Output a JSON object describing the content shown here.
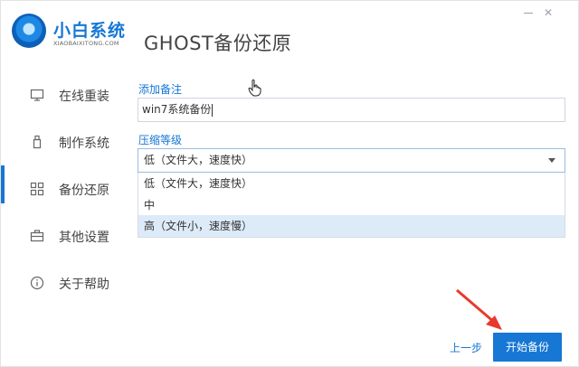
{
  "brand": {
    "name_cn": "小白系统",
    "name_en": "XIAOBAIXITONG.COM",
    "logo_icon": "xiaobai-logo-icon"
  },
  "page_title": "GHOST备份还原",
  "window_controls": {
    "minimize_icon": "minimize-icon",
    "close": "✕"
  },
  "sidebar": {
    "accent_color": "#1677d4",
    "active_index": 2,
    "items": [
      {
        "label": "在线重装",
        "icon": "monitor-icon"
      },
      {
        "label": "制作系统",
        "icon": "usb-drive-icon"
      },
      {
        "label": "备份还原",
        "icon": "grid-icon"
      },
      {
        "label": "其他设置",
        "icon": "toolbox-icon"
      },
      {
        "label": "关于帮助",
        "icon": "info-icon"
      }
    ]
  },
  "form": {
    "remark_label": "添加备注",
    "remark_value": "win7系统备份",
    "level_label": "压缩等级",
    "level_selected": "低（文件大，速度快）",
    "level_options": [
      "低（文件大，速度快）",
      "中",
      "高（文件小，速度慢）"
    ],
    "highlighted_option_index": 2
  },
  "footer": {
    "prev_label": "上一步",
    "start_label": "开始备份"
  },
  "colors": {
    "primary": "#1677d4",
    "option_highlight": "#ddebf9",
    "annotation_arrow": "#e8392e"
  }
}
